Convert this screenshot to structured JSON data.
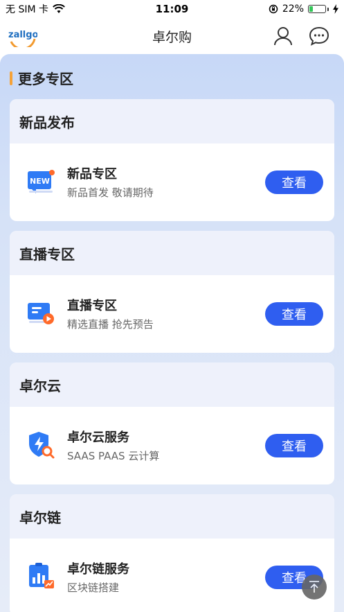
{
  "status_bar": {
    "carrier": "无 SIM 卡",
    "time": "11:09",
    "battery_percent": "22%",
    "battery_level": 0.22
  },
  "nav": {
    "logo_text": "zallgo",
    "title": "卓尔购"
  },
  "section": {
    "title": "更多专区"
  },
  "cards": [
    {
      "header": "新品发布",
      "item_title": "新品专区",
      "item_sub": "新品首发 敬请期待",
      "button": "查看",
      "icon": "new-badge-icon"
    },
    {
      "header": "直播专区",
      "item_title": "直播专区",
      "item_sub": "精选直播 抢先预告",
      "button": "查看",
      "icon": "live-video-icon"
    },
    {
      "header": "卓尔云",
      "item_title": "卓尔云服务",
      "item_sub": "SAAS PAAS 云计算",
      "button": "查看",
      "icon": "cloud-shield-icon"
    },
    {
      "header": "卓尔链",
      "item_title": "卓尔链服务",
      "item_sub": "区块链搭建",
      "button": "查看",
      "icon": "chain-chart-icon"
    }
  ],
  "colors": {
    "accent_orange": "#f5a238",
    "button_blue": "#2f5ef0",
    "card_header_bg": "#eef1fb"
  }
}
